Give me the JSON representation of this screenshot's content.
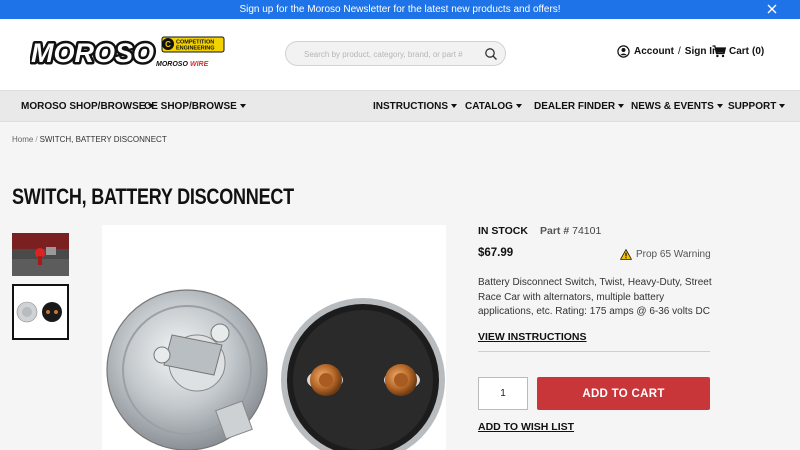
{
  "promo": {
    "text": "Sign up for the Moroso Newsletter for the latest new products and offers!"
  },
  "header": {
    "logo_text": "MOROSO",
    "ce_logo_top": "COMPETITION",
    "ce_logo_bottom": "ENGINEERING",
    "wire_logo_left": "MOROSO",
    "wire_logo_right": "WIRE",
    "search_placeholder": "Search by product, category, brand, or part #",
    "account_label": "Account",
    "account_sep": "/",
    "signin_label": "Sign In",
    "cart_label": "Cart",
    "cart_count": "(0)"
  },
  "nav": {
    "left": [
      "MOROSO SHOP/BROWSE",
      "CE SHOP/BROWSE"
    ],
    "right": [
      "INSTRUCTIONS",
      "CATALOG",
      "DEALER FINDER",
      "NEWS & EVENTS",
      "SUPPORT"
    ]
  },
  "breadcrumb": {
    "home": "Home",
    "sep": "/",
    "current": "SWITCH, BATTERY DISCONNECT"
  },
  "product": {
    "title": "SWITCH, BATTERY DISCONNECT",
    "stock": "IN STOCK",
    "part_label": "Part #",
    "part_number": "74101",
    "price": "$67.99",
    "prop65": "Prop 65 Warning",
    "description": "Battery Disconnect Switch, Twist, Heavy-Duty, Street Race Car with alternators, multiple battery applications, etc. Rating: 175 amps @ 6-36 volts DC",
    "instructions_link": "VIEW INSTRUCTIONS",
    "quantity": "1",
    "add_to_cart": "ADD TO CART",
    "wish_list": "ADD TO WISH LIST"
  },
  "colors": {
    "promo_bg": "#1e73e8",
    "accent_red": "#c8363a",
    "nav_bg": "#e9e9e9",
    "ce_yellow": "#f2d200"
  },
  "icons": [
    "close-icon",
    "search-icon",
    "user-icon",
    "cart-icon",
    "warning-icon",
    "caret-down-icon"
  ]
}
